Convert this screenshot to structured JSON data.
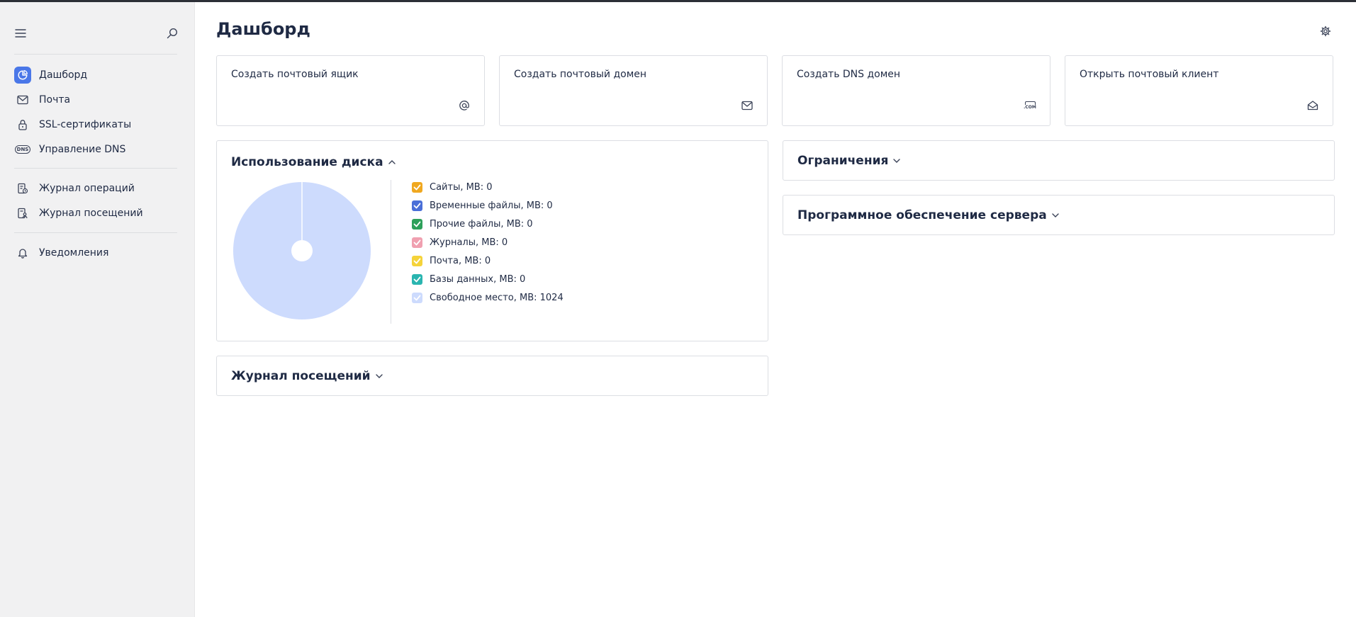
{
  "sidebar": {
    "items": [
      {
        "label": "Дашборд",
        "icon": "chart-pie-icon"
      },
      {
        "label": "Почта",
        "icon": "mail-icon"
      },
      {
        "label": "SSL-сертификаты",
        "icon": "lock-icon"
      },
      {
        "label": "Управление DNS",
        "icon": "dns-icon"
      },
      {
        "label": "Журнал операций",
        "icon": "operations-log-icon"
      },
      {
        "label": "Журнал посещений",
        "icon": "visits-log-icon"
      },
      {
        "label": "Уведомления",
        "icon": "bell-icon"
      }
    ],
    "active": "Дашборд",
    "dns_icon_text": "DNS"
  },
  "header": {
    "title": "Дашборд"
  },
  "actions": [
    {
      "label": "Создать почтовый ящик",
      "icon": "at-icon"
    },
    {
      "label": "Создать почтовый домен",
      "icon": "envelope-icon"
    },
    {
      "label": "Создать DNS домен",
      "icon": "dns-domain-icon",
      "icon_text": ".COM"
    },
    {
      "label": "Открыть почтовый клиент",
      "icon": "open-mail-icon"
    }
  ],
  "panels": {
    "disk_usage": {
      "title": "Использование диска",
      "expanded": true
    },
    "limits": {
      "title": "Ограничения",
      "expanded": false
    },
    "server_software": {
      "title": "Программное обеспечение сервера",
      "expanded": false
    },
    "visits_log": {
      "title": "Журнал посещений",
      "expanded": false
    }
  },
  "chart_data": {
    "type": "pie",
    "title": "Использование диска",
    "labels": [
      "Сайты, MB: 0",
      "Временные файлы, MB: 0",
      "Прочие файлы, MB: 0",
      "Журналы, MB: 0",
      "Почта, MB: 0",
      "Базы данных, MB: 0",
      "Свободное место, MB: 1024"
    ],
    "values": [
      0,
      0,
      0,
      0,
      0,
      0,
      1024
    ],
    "colors": [
      "#f0a820",
      "#4a6fd8",
      "#2ea05a",
      "#f0a0b0",
      "#f5d33a",
      "#2ab5b0",
      "#cddbfd"
    ],
    "checked": [
      true,
      true,
      true,
      true,
      true,
      true,
      true
    ],
    "legend": "right"
  },
  "colors": {
    "accent": "#4a77e8",
    "sidebar_bg": "#f1f1f2",
    "border": "#dcdee3",
    "text": "#1f2a44"
  }
}
